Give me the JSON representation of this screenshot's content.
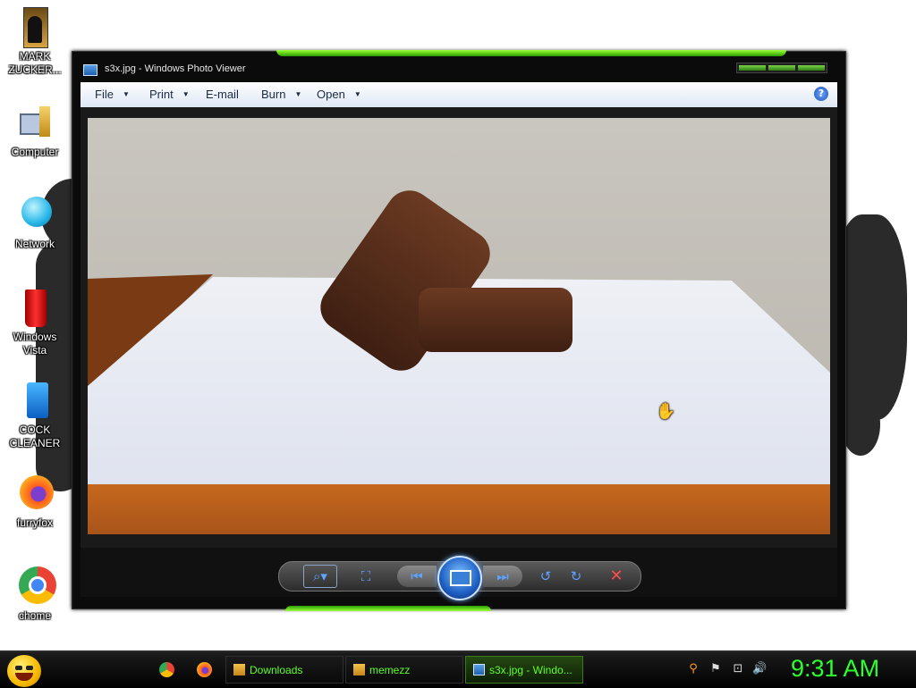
{
  "desktop": {
    "icons": [
      {
        "label": "MARK ZUCKER..."
      },
      {
        "label": "Computer"
      },
      {
        "label": "Network"
      },
      {
        "label": "Windows Vista"
      },
      {
        "label": "COCK CLEANER"
      },
      {
        "label": "furryfox"
      },
      {
        "label": "chome"
      }
    ]
  },
  "window": {
    "title": "s3x.jpg - Windows Photo Viewer",
    "menu": [
      "File",
      "Print",
      "E-mail",
      "Burn",
      "Open"
    ],
    "help_label": "?",
    "controls": [
      "zoom",
      "fit-to-window",
      "previous",
      "slideshow",
      "next",
      "rotate-counterclockwise",
      "rotate-clockwise",
      "delete"
    ]
  },
  "taskbar": {
    "tasks": [
      {
        "label": "Downloads"
      },
      {
        "label": "memezz"
      },
      {
        "label": "s3x.jpg - Windo...",
        "active": true
      }
    ],
    "clock": "9:31 AM"
  },
  "colors": {
    "accent_green": "#2cff2c",
    "window_bg": "#0b0b0b",
    "menu_text": "#1b2a44"
  }
}
